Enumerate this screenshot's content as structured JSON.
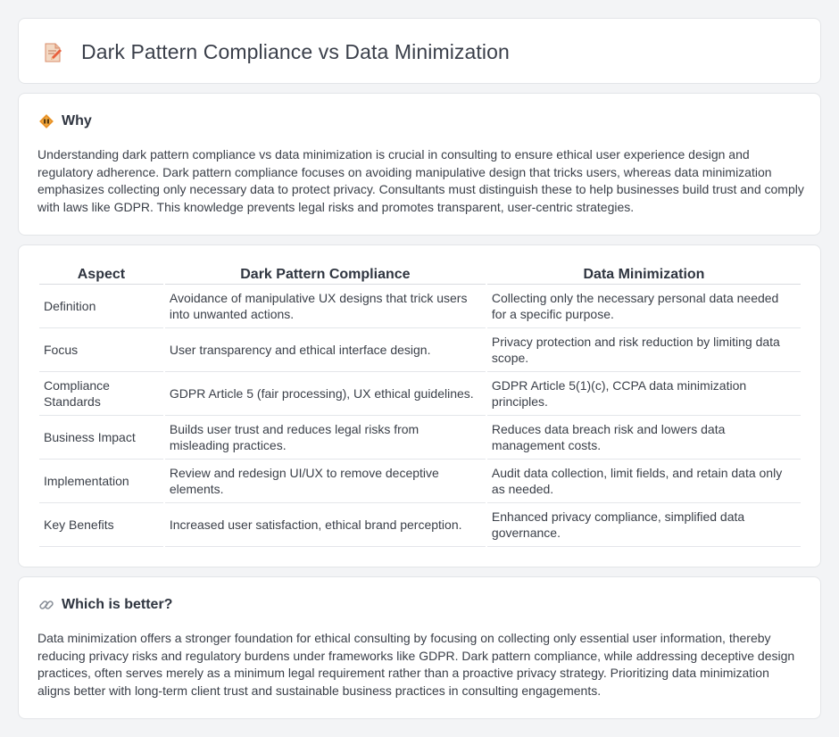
{
  "header": {
    "title": "Dark Pattern Compliance vs Data Minimization",
    "icon": "document-pen-icon"
  },
  "why": {
    "title": "Why",
    "icon": "warning-diamond-icon",
    "body": "Understanding dark pattern compliance vs data minimization is crucial in consulting to ensure ethical user experience design and regulatory adherence. Dark pattern compliance focuses on avoiding manipulative design that tricks users, whereas data minimization emphasizes collecting only necessary data to protect privacy. Consultants must distinguish these to help businesses build trust and comply with laws like GDPR. This knowledge prevents legal risks and promotes transparent, user-centric strategies."
  },
  "table": {
    "headers": [
      "Aspect",
      "Dark Pattern Compliance",
      "Data Minimization"
    ],
    "rows": [
      [
        "Definition",
        "Avoidance of manipulative UX designs that trick users into unwanted actions.",
        "Collecting only the necessary personal data needed for a specific purpose."
      ],
      [
        "Focus",
        "User transparency and ethical interface design.",
        "Privacy protection and risk reduction by limiting data scope."
      ],
      [
        "Compliance Standards",
        "GDPR Article 5 (fair processing), UX ethical guidelines.",
        "GDPR Article 5(1)(c), CCPA data minimization principles."
      ],
      [
        "Business Impact",
        "Builds user trust and reduces legal risks from misleading practices.",
        "Reduces data breach risk and lowers data management costs."
      ],
      [
        "Implementation",
        "Review and redesign UI/UX to remove deceptive elements.",
        "Audit data collection, limit fields, and retain data only as needed."
      ],
      [
        "Key Benefits",
        "Increased user satisfaction, ethical brand perception.",
        "Enhanced privacy compliance, simplified data governance."
      ]
    ]
  },
  "better": {
    "title": "Which is better?",
    "icon": "link-icon",
    "body": "Data minimization offers a stronger foundation for ethical consulting by focusing on collecting only essential user information, thereby reducing privacy risks and regulatory burdens under frameworks like GDPR. Dark pattern compliance, while addressing deceptive design practices, often serves merely as a minimum legal requirement rather than a proactive privacy strategy. Prioritizing data minimization aligns better with long-term client trust and sustainable business practices in consulting engagements."
  }
}
